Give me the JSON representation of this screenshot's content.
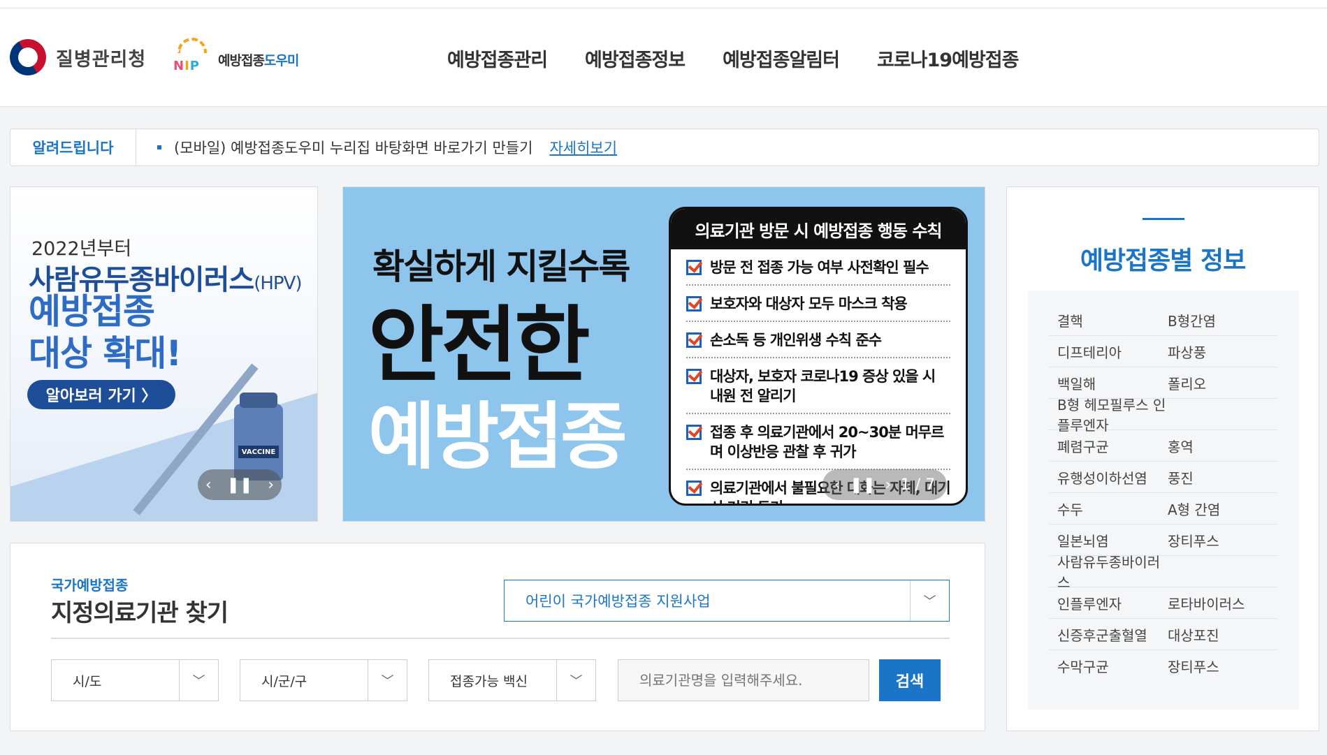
{
  "header": {
    "agency": "질병관리청",
    "logo_letters": [
      "N",
      "I",
      "P"
    ],
    "logo_title": "예방접종",
    "logo_title_accent": "도우미",
    "nav": [
      "예방접종관리",
      "예방접종정보",
      "예방접종알림터",
      "코로나19예방접종"
    ]
  },
  "notice": {
    "tag": "알려드립니다",
    "message": "(모바일) 예방접종도우미 누리집 바탕화면 바로가기 만들기",
    "more": "자세히보기"
  },
  "banner_hpv": {
    "year": "2022년부터",
    "line1": "사람유두종바이러스",
    "line1_suffix": "(HPV)",
    "line2": "예방접종",
    "line3": "대상 확대!",
    "button": "알아보러 가기 〉",
    "vial_label": "VACCINE"
  },
  "banner_safe": {
    "line1": "확실하게 지킬수록",
    "line2": "안전한",
    "line3": "예방접종",
    "card_title": "의료기관 방문 시 예방접종 행동 수칙",
    "rules": [
      "방문 전 접종 가능 여부 사전확인 필수",
      "보호자와 대상자 모두 마스크 착용",
      "손소독 등 개인위생 수칙 준수",
      "대상자, 보호자 코로나19 증상 있을 시 내원 전 알리기",
      "접종 후 의료기관에서 20~30분 머무르며 이상반응 관찰 후 귀가",
      "의료기관에서 불필요한 대화는 자제, 대기 시 거리 두기"
    ],
    "pager": "1 / 7"
  },
  "find": {
    "subtitle": "국가예방접종",
    "title": "지정의료기관 찾기",
    "program": "어린이 국가예방접종 지원사업",
    "sido": "시/도",
    "sigungu": "시/군/구",
    "vaccine": "접종가능 백신",
    "keyword_placeholder": "의료기관명을 입력해주세요.",
    "search": "검색"
  },
  "side": {
    "title": "예방접종별 정보",
    "rows": [
      [
        "결핵",
        "B형간염"
      ],
      [
        "디프테리아",
        "파상풍"
      ],
      [
        "백일해",
        "폴리오"
      ],
      [
        "B형 헤모필루스 인플루엔자",
        ""
      ],
      [
        "폐렴구균",
        "홍역"
      ],
      [
        "유행성이하선염",
        "풍진"
      ],
      [
        "수두",
        "A형 간염"
      ],
      [
        "일본뇌염",
        "장티푸스"
      ],
      [
        "사람유두종바이러스",
        ""
      ],
      [
        "인플루엔자",
        "로타바이러스"
      ],
      [
        "신증후군출혈열",
        "대상포진"
      ],
      [
        "수막구균",
        "장티푸스"
      ]
    ]
  },
  "colors": {
    "accent": "#1a75c9",
    "banner_blue": "#8ec5ec",
    "navy": "#1f4e99"
  }
}
